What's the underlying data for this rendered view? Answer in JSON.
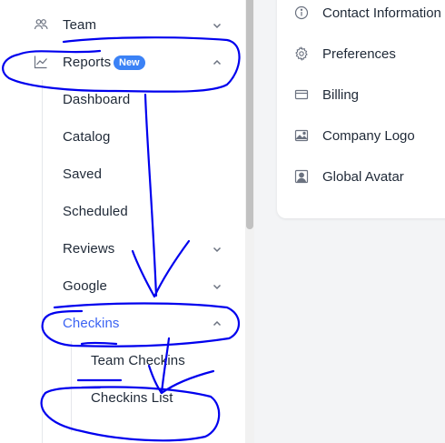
{
  "sidebar": {
    "items": [
      {
        "label": "Team",
        "icon": "team-icon",
        "expanded": false
      },
      {
        "label": "Reports",
        "icon": "chart-line-icon",
        "badge": "New",
        "expanded": true
      },
      {
        "label": "Dashboard"
      },
      {
        "label": "Catalog"
      },
      {
        "label": "Saved"
      },
      {
        "label": "Scheduled"
      },
      {
        "label": "Reviews",
        "expanded": false
      },
      {
        "label": "Google",
        "expanded": false
      },
      {
        "label": "Checkins",
        "expanded": true,
        "active": true
      },
      {
        "label": "Team Checkins"
      },
      {
        "label": "Checkins List"
      }
    ]
  },
  "settings_menu": {
    "items": [
      {
        "label": "Contact Information",
        "icon": "info-icon"
      },
      {
        "label": "Preferences",
        "icon": "gear-icon"
      },
      {
        "label": "Billing",
        "icon": "credit-card-icon"
      },
      {
        "label": "Company Logo",
        "icon": "image-icon"
      },
      {
        "label": "Global Avatar",
        "icon": "user-portrait-icon"
      }
    ]
  },
  "colors": {
    "active": "#3b63f3",
    "badge": "#3b82f6",
    "annotation_ink": "#0000ee"
  }
}
